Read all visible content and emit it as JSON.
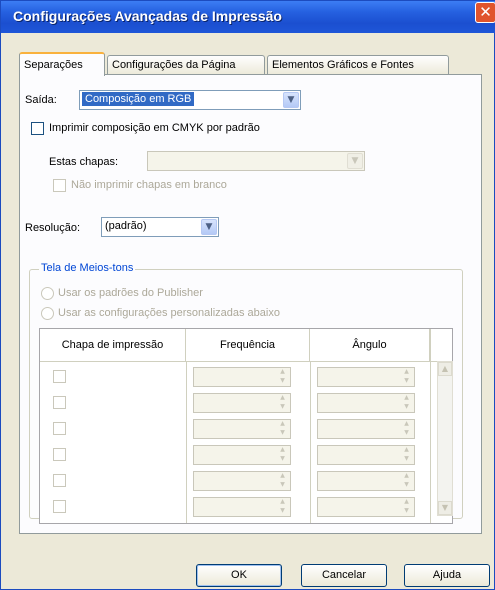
{
  "window": {
    "title": "Configurações Avançadas de Impressão",
    "close": "✕"
  },
  "tabs": [
    {
      "label": "Separações"
    },
    {
      "label": "Configurações da Página"
    },
    {
      "label": "Elementos Gráficos e Fontes"
    }
  ],
  "output": {
    "label": "Saída:",
    "value": "Composição em RGB"
  },
  "cmyk_checkbox": {
    "label": "Imprimir composição em CMYK por padrão"
  },
  "plates": {
    "label": "Estas chapas:",
    "value": ""
  },
  "blank_plates_checkbox": {
    "label": "Não imprimir chapas em branco"
  },
  "resolution": {
    "label": "Resolução:",
    "value": "(padrão)"
  },
  "halftone": {
    "title": "Tela de Meios-tons",
    "radio_publisher": "Usar os padrões do Publisher",
    "radio_custom": "Usar as configurações personalizadas abaixo"
  },
  "grid": {
    "headers": [
      "Chapa de impressão",
      "Frequência",
      "Ângulo"
    ],
    "rows": [
      {
        "frequency": "",
        "angle": ""
      },
      {
        "frequency": "",
        "angle": ""
      },
      {
        "frequency": "",
        "angle": ""
      },
      {
        "frequency": "",
        "angle": ""
      },
      {
        "frequency": "",
        "angle": ""
      },
      {
        "frequency": "",
        "angle": ""
      }
    ]
  },
  "buttons": {
    "ok": "OK",
    "cancel": "Cancelar",
    "help": "Ajuda"
  },
  "icons": {
    "dropdown": "chevron-down-icon",
    "spin_up": "spin-up-icon",
    "spin_down": "spin-down-icon",
    "scroll_up": "scroll-up-icon",
    "scroll_down": "scroll-down-icon",
    "close": "close-icon"
  },
  "colors": {
    "titlebar": "#2560e0",
    "selection": "#316ac5",
    "group_title": "#0046d5",
    "close_button": "#e0542d"
  }
}
